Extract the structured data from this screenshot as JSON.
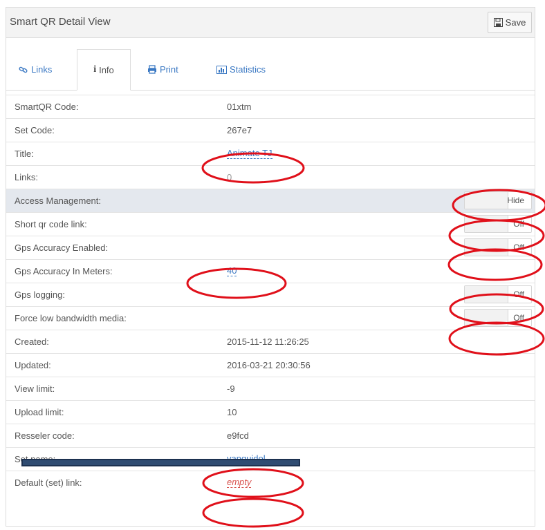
{
  "header": {
    "title": "Smart QR Detail View",
    "save_label": "Save"
  },
  "tabs": [
    {
      "label": "Links",
      "icon": "link-icon",
      "active": false
    },
    {
      "label": "Info",
      "icon": "info-icon",
      "active": true
    },
    {
      "label": "Print",
      "icon": "print-icon",
      "active": false
    },
    {
      "label": "Statistics",
      "icon": "bar-chart-icon",
      "active": false
    }
  ],
  "fields": {
    "smartqr_code": {
      "label": "SmartQR Code:",
      "value": "01xtm"
    },
    "set_code": {
      "label": "Set Code:",
      "value": "267e7"
    },
    "title": {
      "label": "Title:",
      "value": "Animate TJ"
    },
    "links": {
      "label": "Links:",
      "value": "0"
    },
    "access_management": {
      "label": "Access Management:",
      "toggle": "Hide"
    },
    "short_qr_link": {
      "label": "Short qr code link:",
      "toggle": "Off"
    },
    "gps_accuracy_enabled": {
      "label": "Gps Accuracy Enabled:",
      "toggle": "Off"
    },
    "gps_accuracy_meters": {
      "label": "Gps Accuracy In Meters:",
      "value": "40"
    },
    "gps_logging": {
      "label": "Gps logging:",
      "toggle": "Off"
    },
    "force_low_bandwidth": {
      "label": "Force low bandwidth media:",
      "toggle": "Off"
    },
    "created": {
      "label": "Created:",
      "value": "2015-11-12 11:26:25"
    },
    "updated": {
      "label": "Updated:",
      "value": "2016-03-21 20:30:56"
    },
    "view_limit": {
      "label": "View limit:",
      "value": "-9"
    },
    "upload_limit": {
      "label": "Upload limit:",
      "value": "10"
    },
    "reseller_code": {
      "label": "Resseler code:",
      "value": "e9fcd"
    },
    "set_name": {
      "label": "Set name:",
      "value": "vanguidol"
    },
    "default_set_link": {
      "label": "Default (set) link:",
      "value": "empty"
    }
  },
  "colors": {
    "link": "#3a78c3",
    "annotation": "#e0101a",
    "highlight_row": "#e4e8ee",
    "redaction": "#2f4c72"
  }
}
